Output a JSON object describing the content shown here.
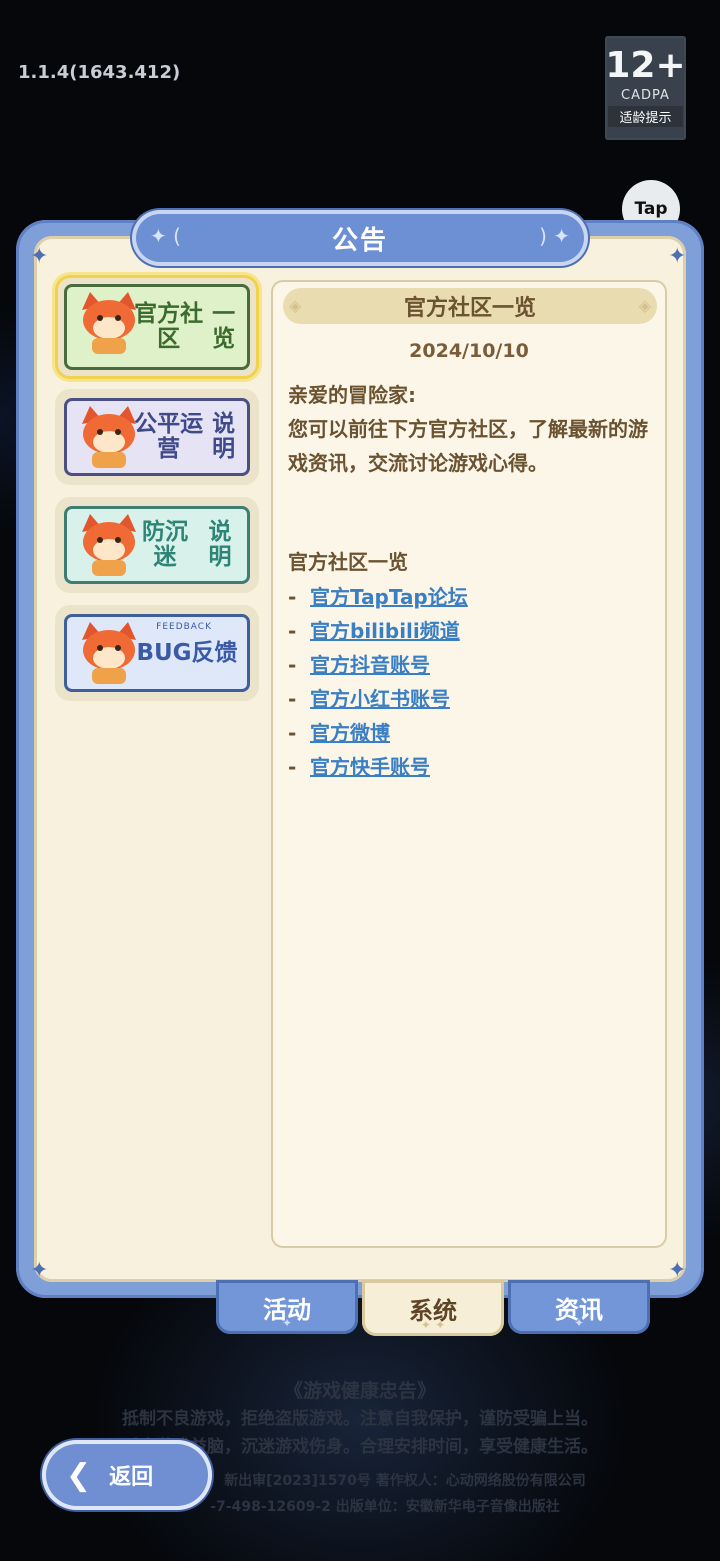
{
  "version": "1.1.4(1643.412)",
  "age_badge": {
    "number": "12+",
    "org": "CADPA",
    "tip": "适龄提示"
  },
  "tap_icon": {
    "label": "Tap"
  },
  "dialog": {
    "title": "公告"
  },
  "sidebar": {
    "items": [
      {
        "label": "官方社区一览",
        "line1": "官方社区",
        "line2": "一览",
        "bg": "#dff1c8",
        "border": "#4a6b3c",
        "text_color": "#3c6b2f",
        "active": true
      },
      {
        "label": "公平运营说明",
        "line1": "公平运营",
        "line2": "说明",
        "bg": "#e6e3f5",
        "border": "#4b4f82",
        "text_color": "#3e4a89",
        "active": false
      },
      {
        "label": "防沉迷说明",
        "line1": "防沉迷",
        "line2": "说明",
        "bg": "#d8f1ea",
        "border": "#3e7d72",
        "text_color": "#2e8476",
        "active": false
      },
      {
        "label": "BUG反馈",
        "line1": "BUG反馈",
        "line2": "",
        "small": "FEEDBACK",
        "bg": "#dfe8f8",
        "border": "#3f5e9c",
        "text_color": "#3a5aa8",
        "active": false
      }
    ]
  },
  "content": {
    "header": "官方社区一览",
    "date": "2024/10/10",
    "greeting": "亲爱的冒险家:",
    "paragraph": "您可以前往下方官方社区，了解最新的游戏资讯，交流讨论游戏心得。",
    "section_title": "官方社区一览",
    "links": [
      {
        "dash": "-",
        "text": "官方TapTap论坛"
      },
      {
        "dash": "-",
        "text": "官方bilibili频道"
      },
      {
        "dash": "-",
        "text": "官方抖音账号"
      },
      {
        "dash": "-",
        "text": "官方小红书账号"
      },
      {
        "dash": "-",
        "text": "官方微博"
      },
      {
        "dash": "-",
        "text": "官方快手账号"
      }
    ]
  },
  "bottom_tabs": [
    {
      "label": "活动",
      "active": false
    },
    {
      "label": "系统",
      "active": true
    },
    {
      "label": "资讯",
      "active": false
    }
  ],
  "footer": {
    "line1": "《游戏健康忠告》",
    "line2": "抵制不良游戏，拒绝盗版游戏。注意自我保护，谨防受骗上当。",
    "line3": "适度游戏益脑，沉迷游戏伤身。合理安排时间，享受健康生活。",
    "line4": "新出审[2023]1570号  著作权人：心动网络股份有限公司",
    "line5": "-7-498-12609-2     出版单位：安徽新华电子音像出版社"
  },
  "back_button": {
    "label": "返回"
  }
}
